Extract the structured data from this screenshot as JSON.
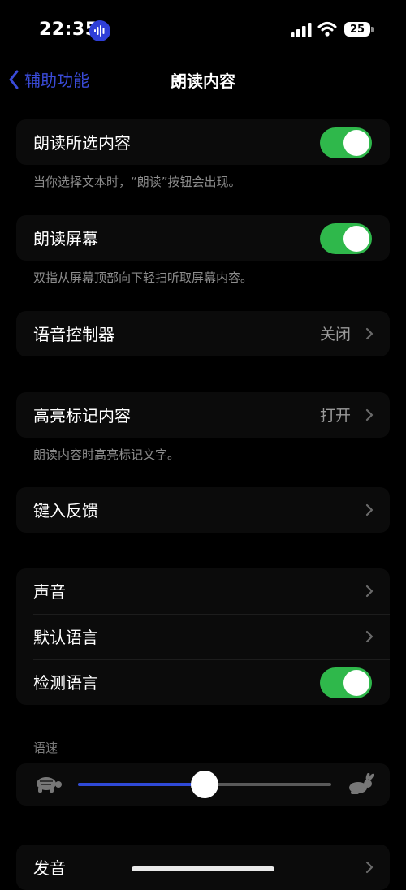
{
  "status": {
    "time": "22:35",
    "battery": "25"
  },
  "nav": {
    "back_label": "辅助功能",
    "title": "朗读内容"
  },
  "speak_selection": {
    "label": "朗读所选内容",
    "on": true,
    "footnote": "当你选择文本时，“朗读”按钮会出现。"
  },
  "speak_screen": {
    "label": "朗读屏幕",
    "on": true,
    "footnote": "双指从屏幕顶部向下轻扫听取屏幕内容。"
  },
  "speech_controller": {
    "label": "语音控制器",
    "value": "关闭"
  },
  "highlight": {
    "label": "高亮标记内容",
    "value": "打开",
    "footnote": "朗读内容时高亮标记文字。"
  },
  "typing_feedback": {
    "label": "键入反馈"
  },
  "voices": {
    "label": "声音"
  },
  "default_language": {
    "label": "默认语言"
  },
  "detect_language": {
    "label": "检测语言",
    "on": true
  },
  "speaking_rate": {
    "header": "语速",
    "value": 0.5
  },
  "pronunciations": {
    "label": "发音"
  },
  "colors": {
    "toggle_on": "#2fb84b",
    "accent": "#3a4bd9",
    "slider_fill": "#2f4ad8"
  }
}
